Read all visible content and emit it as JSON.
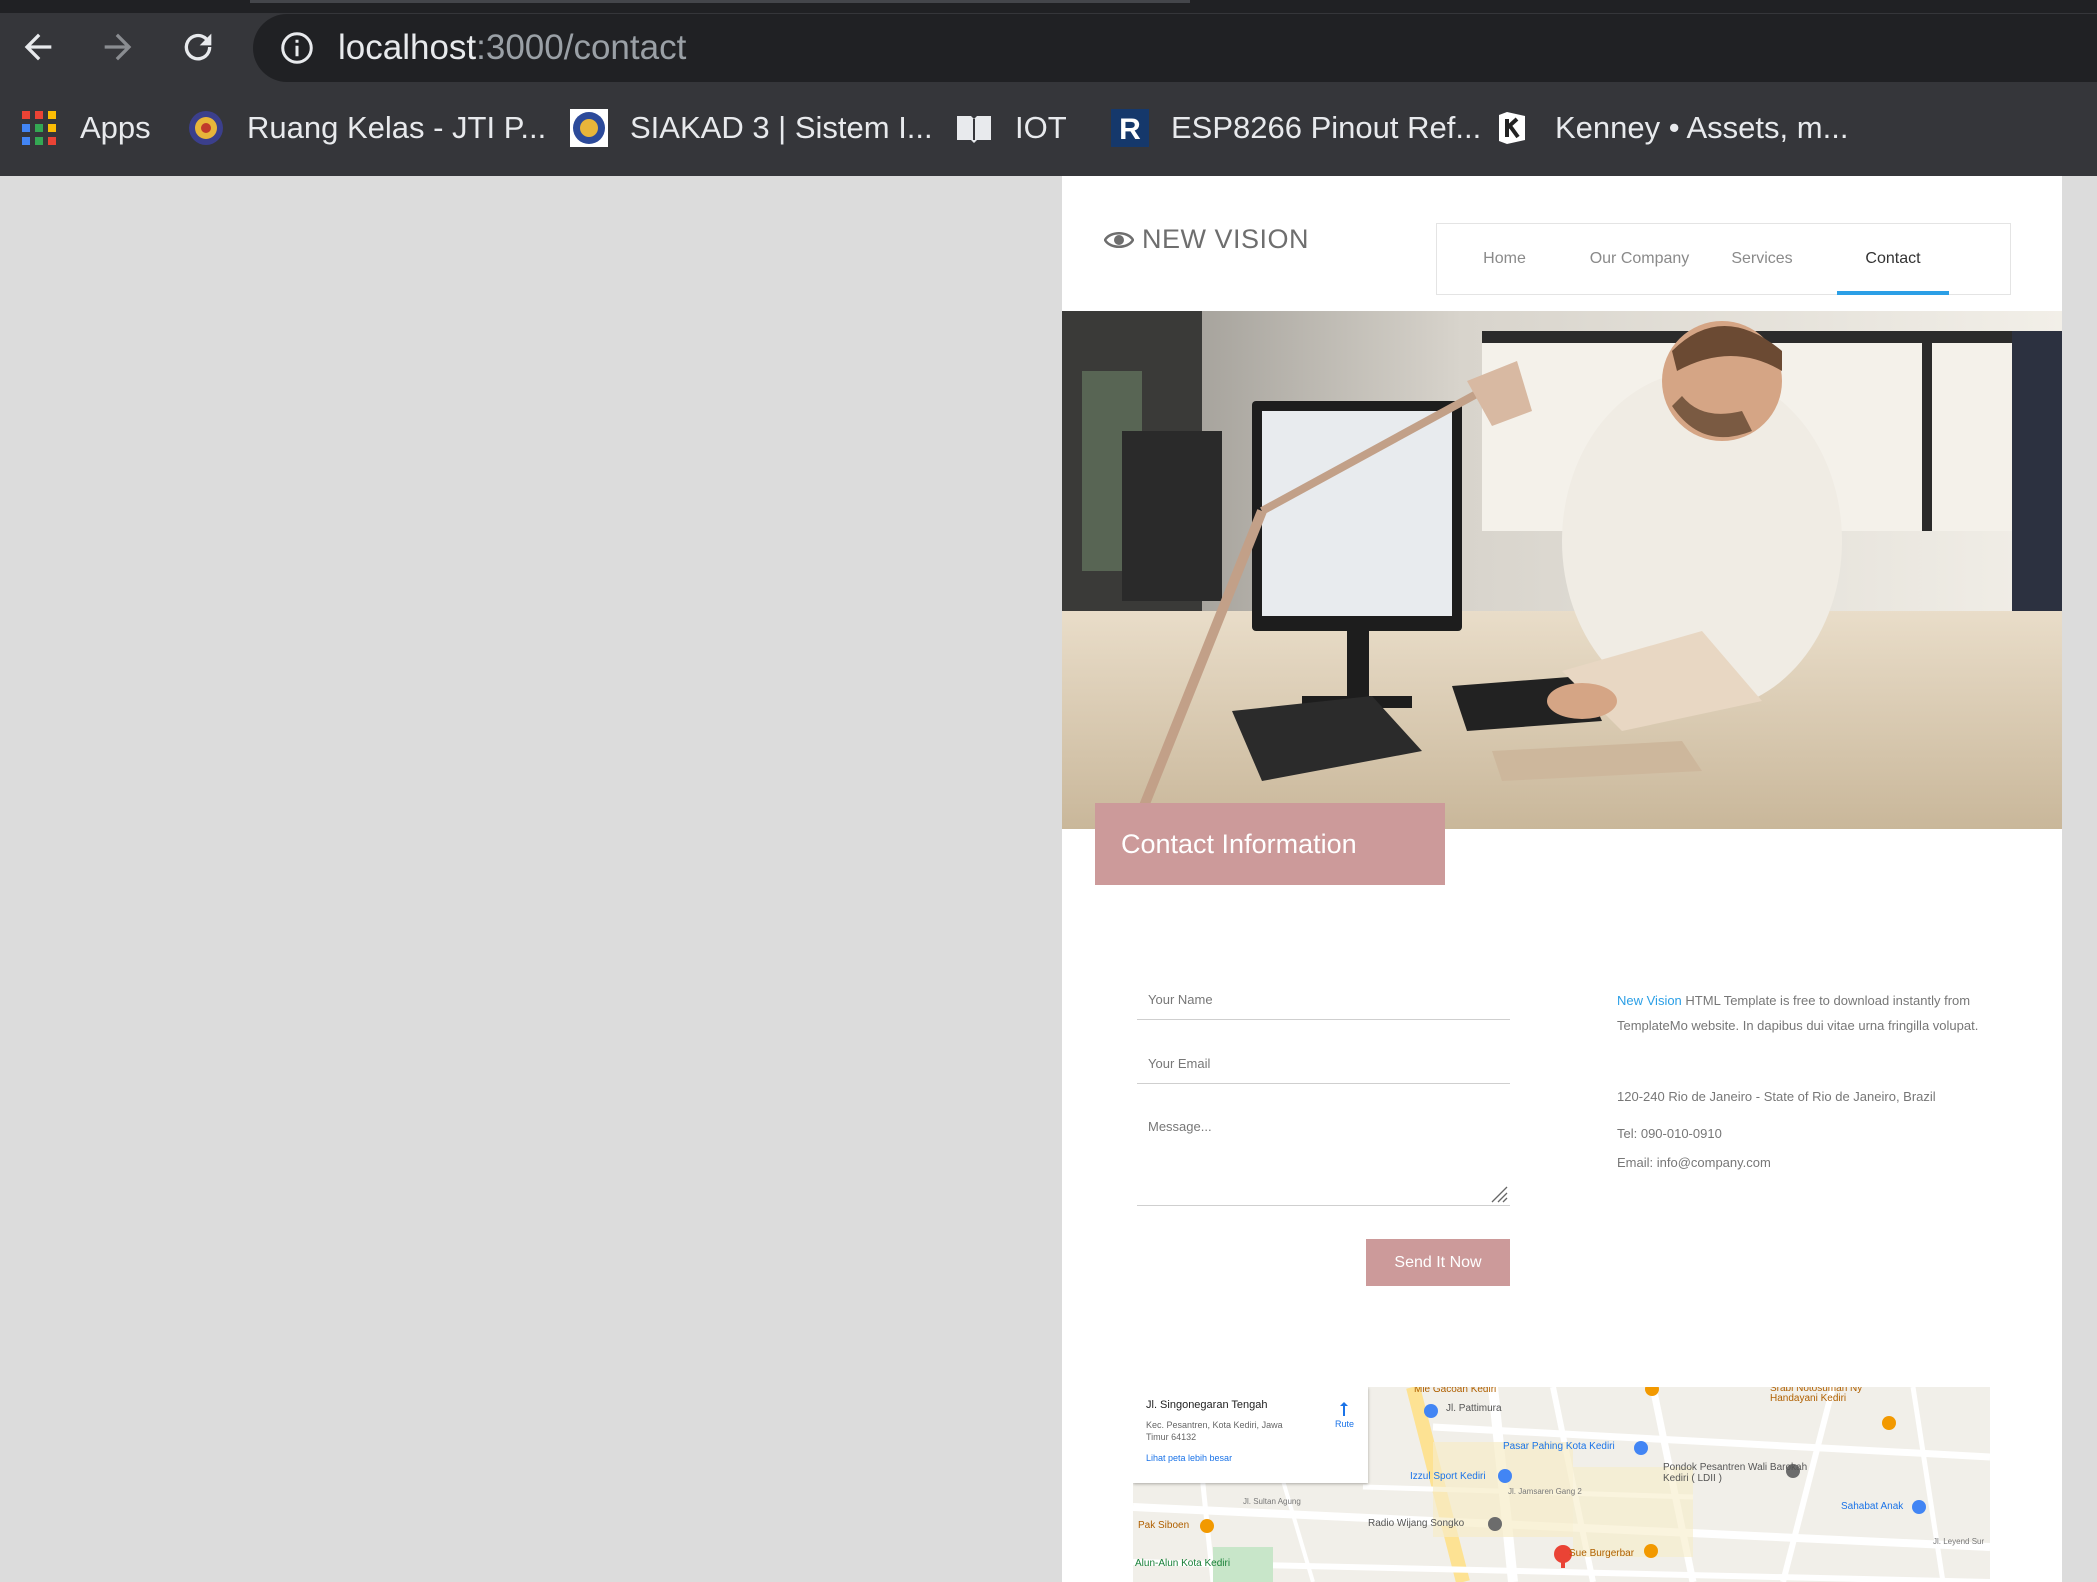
{
  "browser": {
    "url_host": "localhost",
    "url_rest": ":3000/contact",
    "bookmarks": [
      {
        "label": "Apps",
        "icon": "apps-grid-icon"
      },
      {
        "label": "Ruang Kelas - JTI P...",
        "icon": "university-logo-icon"
      },
      {
        "label": "SIAKAD 3 | Sistem I...",
        "icon": "university-logo-icon"
      },
      {
        "label": "IOT",
        "icon": "book-icon"
      },
      {
        "label": "ESP8266 Pinout Ref...",
        "icon": "r-letter-icon"
      },
      {
        "label": "Kenney • Assets, m...",
        "icon": "kenney-k-icon"
      }
    ]
  },
  "site": {
    "logo_text": "NEW VISION",
    "menu": [
      {
        "label": "Home",
        "active": false
      },
      {
        "label": "Our Company",
        "active": false
      },
      {
        "label": "Services",
        "active": false
      },
      {
        "label": "Contact",
        "active": true
      }
    ],
    "hero_alt": "",
    "contact_heading": "Contact Information"
  },
  "form": {
    "name_placeholder": "Your Name",
    "email_placeholder": "Your Email",
    "message_placeholder": "Message...",
    "submit_label": "Send It Now"
  },
  "info": {
    "brand_link": "New Vision",
    "intro_rest": " HTML Template is free to download instantly from TemplateMo website. In dapibus dui vitae urna fringilla volupat.",
    "address": "120-240 Rio de Janeiro - State of Rio de Janeiro, Brazil",
    "tel": "Tel: 090-010-0910",
    "email": "Email: info@company.com"
  },
  "map": {
    "place_title": "Jl. Singonegaran Tengah",
    "place_address": "Kec. Pesantren, Kota Kediri, Jawa Timur 64132",
    "larger_map_link": "Lihat peta lebih besar",
    "directions_label": "Rute",
    "labels": [
      "Mie Gacoan Kediri",
      "Jl. Pattimura",
      "Srabi Notosuman Ny Handayani Kediri",
      "Pasar Pahing Kota Kediri",
      "Pondok Pesantren Wali Barokah Kediri ( LDII )",
      "Izzul Sport Kediri",
      "Sahabat Anak",
      "Pak Siboen",
      "Radio Wijang Songko",
      "Jl. Jamsaren Gang 2",
      "Alun-Alun Kota Kediri",
      "Jl. Sultan Agung",
      "Sue Burgerbar",
      "Jl. Leyend Sur"
    ],
    "colors": {
      "pin": "#ea4335",
      "poi_orange": "#f29900",
      "poi_blue": "#4285f4",
      "road": "#ffffff",
      "major_road": "#fde293"
    }
  },
  "colors": {
    "accent_pink": "#cc9a9a",
    "accent_blue": "#2b9fe6",
    "chrome_bg": "#35363a"
  }
}
